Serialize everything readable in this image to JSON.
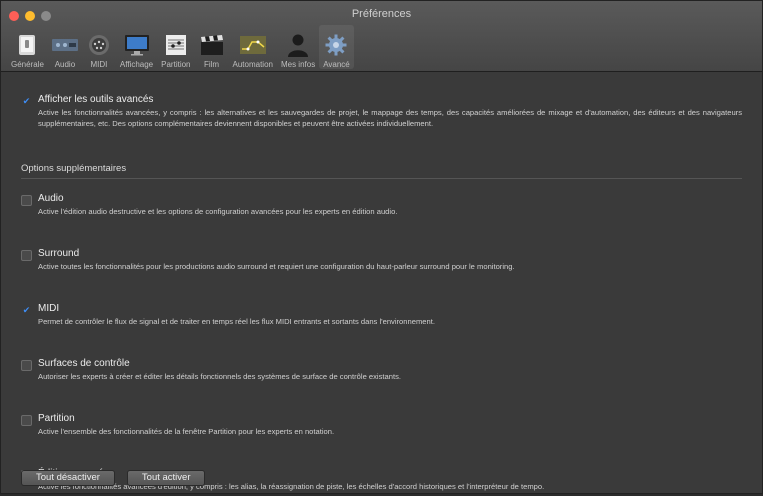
{
  "window": {
    "title": "Préférences"
  },
  "toolbar": {
    "items": [
      {
        "label": "Générale",
        "icon": "phone-switch-icon"
      },
      {
        "label": "Audio",
        "icon": "audio-interface-icon"
      },
      {
        "label": "MIDI",
        "icon": "midi-connector-icon"
      },
      {
        "label": "Affichage",
        "icon": "display-icon"
      },
      {
        "label": "Partition",
        "icon": "score-icon"
      },
      {
        "label": "Film",
        "icon": "clapperboard-icon"
      },
      {
        "label": "Automation",
        "icon": "automation-icon"
      },
      {
        "label": "Mes infos",
        "icon": "user-silhouette-icon"
      },
      {
        "label": "Avancé",
        "icon": "gear-icon"
      }
    ]
  },
  "main_option": {
    "title": "Afficher les outils avancés",
    "checked": true,
    "description": "Active les fonctionnalités avancées, y compris : les alternatives et les sauvegardes de projet, le mappage des temps, des capacités améliorées de mixage et d'automation, des éditeurs et des navigateurs supplémentaires, etc. Des options complémentaires deviennent disponibles et peuvent être activées individuellement."
  },
  "section": {
    "title": "Options supplémentaires"
  },
  "options": [
    {
      "title": "Audio",
      "checked": false,
      "description": "Active l'édition audio destructive et les options de configuration avancées pour les experts en édition audio."
    },
    {
      "title": "Surround",
      "checked": false,
      "description": "Active toutes les fonctionnalités pour les productions audio surround et requiert une configuration du haut-parleur surround pour le monitoring."
    },
    {
      "title": "MIDI",
      "checked": true,
      "description": "Permet de contrôler le flux de signal et de traiter en temps réel les flux MIDI entrants et sortants dans l'environnement."
    },
    {
      "title": "Surfaces de contrôle",
      "checked": false,
      "description": "Autoriser les experts à créer et éditer les détails fonctionnels des systèmes de surface de contrôle existants."
    },
    {
      "title": "Partition",
      "checked": false,
      "description": "Active l'ensemble des fonctionnalités de la fenêtre Partition pour les experts en notation."
    },
    {
      "title": "Édition avancée",
      "checked": false,
      "description": "Active les fonctionnalités avancées d'édition, y compris : les alias, la réassignation de piste, les échelles d'accord historiques et l'interpréteur de tempo."
    }
  ],
  "buttons": {
    "disable_all": "Tout désactiver",
    "enable_all": "Tout activer"
  },
  "colors": {
    "accent": "#3e8ef7",
    "background": "#3a3a3a"
  }
}
